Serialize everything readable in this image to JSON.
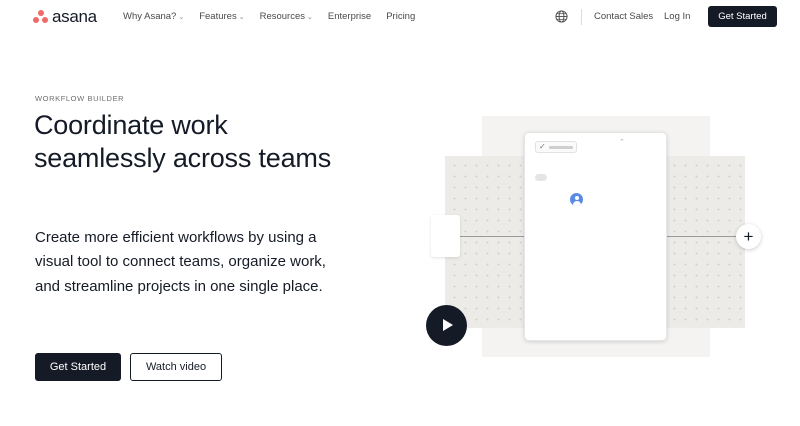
{
  "brand": {
    "name": "asana",
    "color": "#f06a6a"
  },
  "nav": {
    "links": [
      {
        "label": "Why Asana?",
        "dropdown": true
      },
      {
        "label": "Features",
        "dropdown": true
      },
      {
        "label": "Resources",
        "dropdown": true
      },
      {
        "label": "Enterprise",
        "dropdown": false
      },
      {
        "label": "Pricing",
        "dropdown": false
      }
    ],
    "language_icon": "globe-icon",
    "contact_label": "Contact Sales",
    "login_label": "Log In",
    "cta_label": "Get Started"
  },
  "hero": {
    "eyebrow": "WORKFLOW BUILDER",
    "headline": "Coordinate work seamlessly across teams",
    "subtext": "Create more efficient workflows by using a visual tool to connect teams, organize work, and streamline projects in one single place.",
    "primary_cta": "Get Started",
    "secondary_cta": "Watch video"
  },
  "illustration": {
    "add_icon": "plus-icon",
    "play_icon": "play-icon",
    "avatar_color": "#5b8be5",
    "task_check": "✓",
    "plus_glyph": "+"
  },
  "colors": {
    "dark": "#151b26",
    "canvas": "#ecebe8"
  }
}
